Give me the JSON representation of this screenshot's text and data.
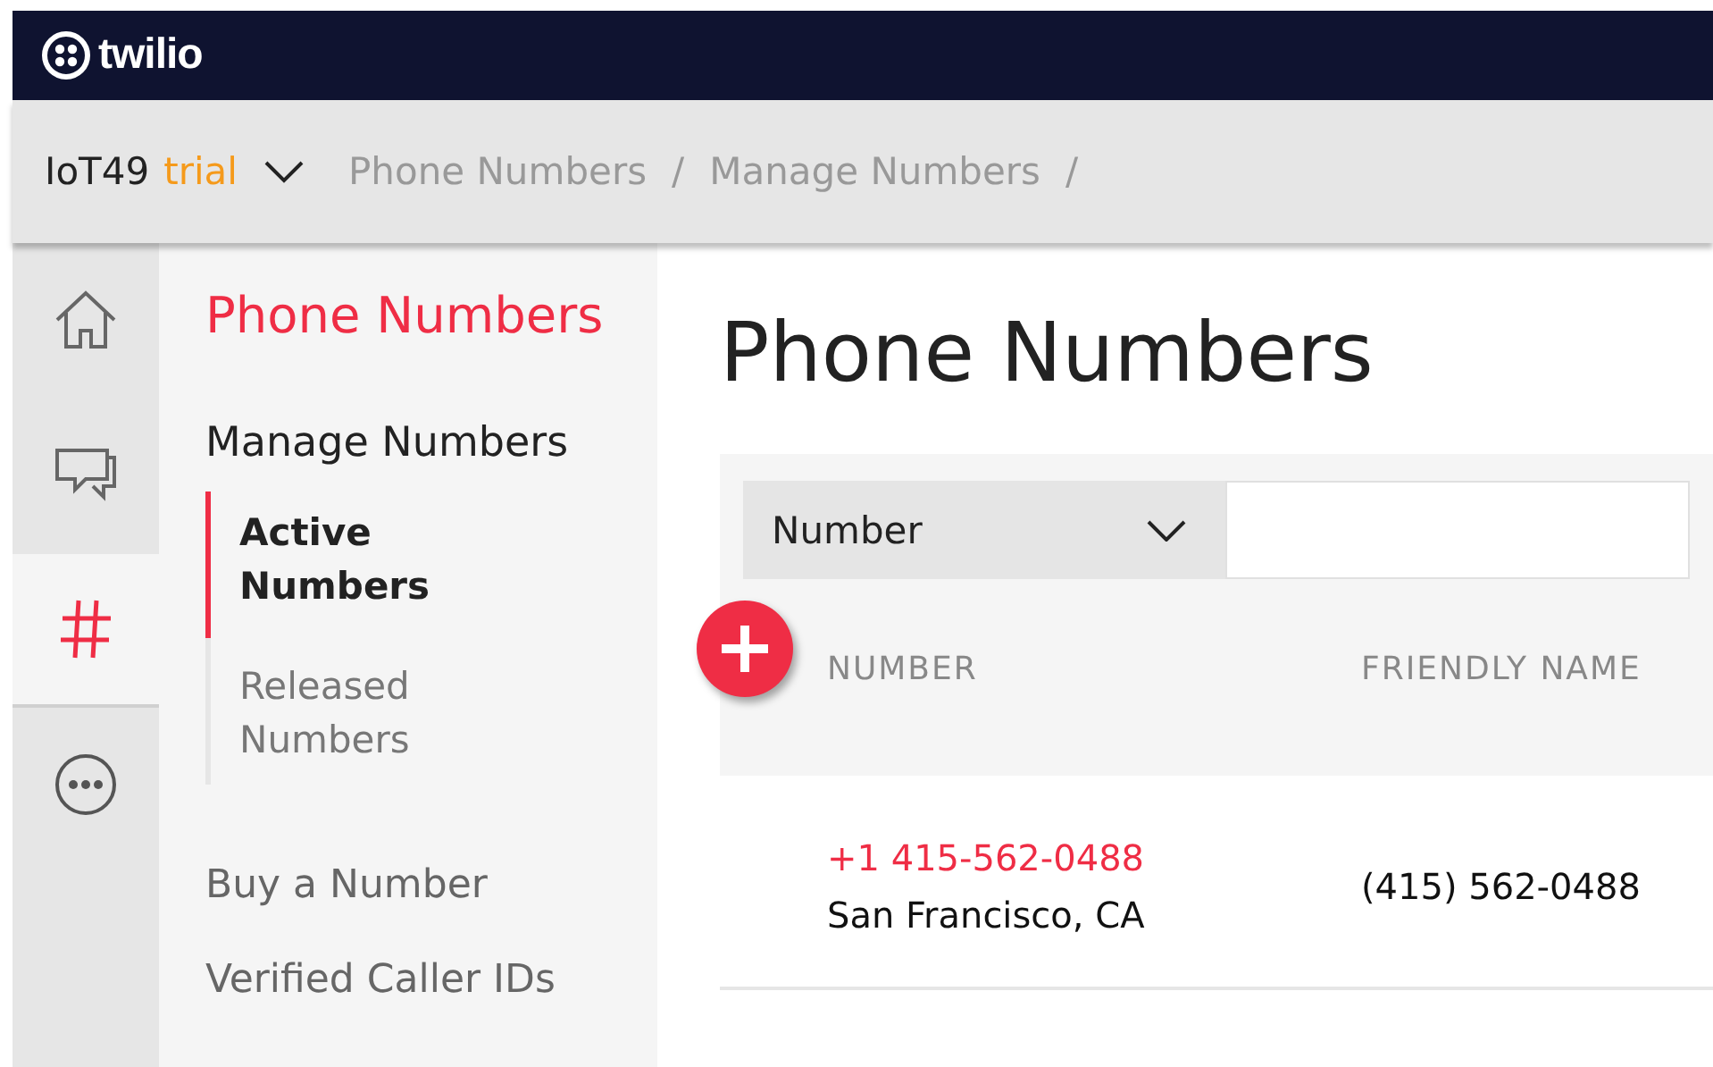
{
  "topbar": {
    "logo": "twilio"
  },
  "breadcrumb_bar": {
    "project": "IoT49",
    "plan": "trial",
    "crumbs": [
      "Phone Numbers",
      "Manage Numbers"
    ],
    "separator": "/"
  },
  "rail": [
    {
      "kind": "home",
      "selected": false
    },
    {
      "kind": "chat",
      "selected": false
    },
    {
      "kind": "hash",
      "selected": true
    },
    {
      "kind": "more",
      "selected": false
    }
  ],
  "subnav": {
    "title": "Phone Numbers",
    "section": "Manage Numbers",
    "items": [
      {
        "label": "Active Numbers",
        "selected": true
      },
      {
        "label": "Released Numbers",
        "selected": false
      }
    ],
    "links": [
      "Buy a Number",
      "Verified Caller IDs"
    ]
  },
  "main": {
    "title": "Phone Numbers",
    "filter": {
      "field": "Number"
    },
    "columns": [
      "NUMBER",
      "FRIENDLY NAME"
    ],
    "rows": [
      {
        "number": "+1 415-562-0488",
        "location": "San Francisco, CA",
        "friendly_name": "(415) 562-0488"
      }
    ]
  }
}
